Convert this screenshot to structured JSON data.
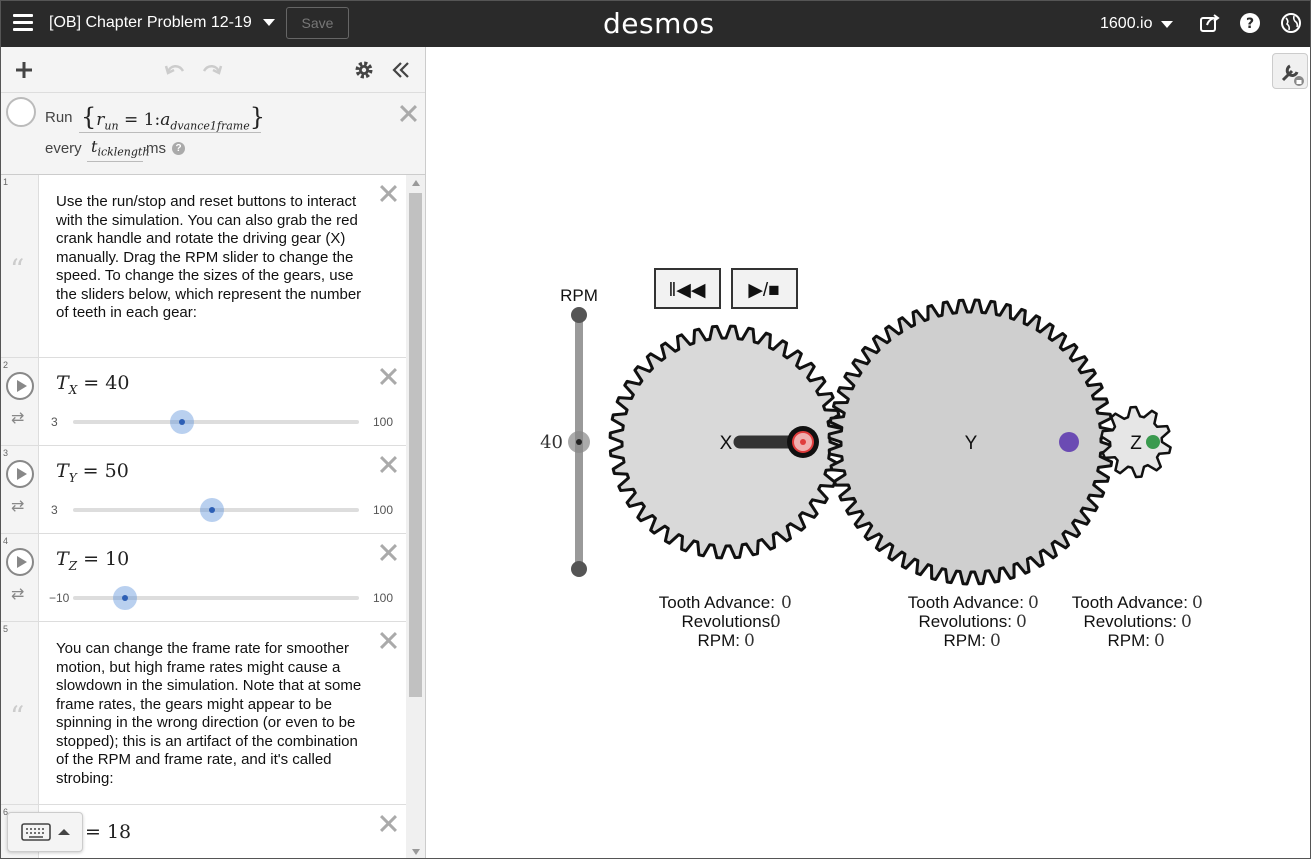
{
  "header": {
    "document_title": "[OB] Chapter Problem 12-19",
    "save_label": "Save",
    "brand": "desmos",
    "account": "1600.io"
  },
  "ticker": {
    "run_label": "Run",
    "expression_open": "{",
    "expression_r": "r",
    "expression_r_sub": "un",
    "expression_mid": " = 1:",
    "expression_a": "a",
    "expression_a_sub": "dvance1frame",
    "expression_close": "}",
    "every_label": "every",
    "interval_t": "t",
    "interval_t_sub": "icklength",
    "ms_label": "ms",
    "help_mark": "?"
  },
  "expressions": [
    {
      "num": "1",
      "type": "note",
      "text": "Use the run/stop and reset buttons to interact with the simulation. You can also grab the red crank handle and rotate the driving gear (X) manually. Drag the RPM slider to change the speed. To change the sizes of the gears, use the sliders below, which represent the number of teeth in each gear:"
    },
    {
      "num": "2",
      "type": "slider",
      "var": "T",
      "sub": "X",
      "equals": "= 40",
      "min": "3",
      "max": "100",
      "value": 40
    },
    {
      "num": "3",
      "type": "slider",
      "var": "T",
      "sub": "Y",
      "equals": "= 50",
      "min": "3",
      "max": "100",
      "value": 50
    },
    {
      "num": "4",
      "type": "slider",
      "var": "T",
      "sub": "Z",
      "equals": "= 10",
      "min": "−10",
      "max": "100",
      "value": 10
    },
    {
      "num": "5",
      "type": "note",
      "text": "You can change the frame rate for smoother motion, but high frame rates might cause a slowdown in the simulation. Note that at some frame rates, the gears might appear to be spinning in the wrong direction (or even to be stopped); this is an artifact of the combination of the RPM and frame rate, and it's called strobing:"
    },
    {
      "num": "6",
      "type": "partial",
      "equals": "= 18"
    }
  ],
  "graph": {
    "rpm_label": "RPM",
    "rpm_value": "40",
    "reset_button": "‖◀◀",
    "run_stop_button": "▶/■",
    "gears": [
      {
        "label": "X",
        "teeth": 40,
        "tooth_advance_label": "Tooth Advance:",
        "tooth_advance": "0",
        "revolutions_label": "Revolutions:",
        "revolutions": "0",
        "rpm_label": "RPM:",
        "rpm": "0"
      },
      {
        "label": "Y",
        "teeth": 50,
        "tooth_advance_label": "Tooth Advance:",
        "tooth_advance": "0",
        "revolutions_label": "Revolutions:",
        "revolutions": "0",
        "rpm_label": "RPM:",
        "rpm": "0"
      },
      {
        "label": "Z",
        "teeth": 10,
        "tooth_advance_label": "Tooth Advance:",
        "tooth_advance": "0",
        "revolutions_label": "Revolutions:",
        "revolutions": "0",
        "rpm_label": "RPM:",
        "rpm": "0"
      }
    ]
  },
  "colors": {
    "header_bg": "#2a2a2a",
    "gear_fill_x": "#d9d9d9",
    "gear_fill_y": "#cfcfcf",
    "gear_fill_z": "#e6e6e6",
    "crank_handle": "#e03c3c",
    "y_marker": "#6b4bb3",
    "z_marker": "#3a9a4f",
    "slider_thumb": "#2d5fb5"
  },
  "icons": {
    "menu": "hamburger-icon",
    "share": "share-icon",
    "help": "help-icon",
    "language": "globe-icon",
    "add": "plus-icon",
    "undo": "undo-icon",
    "redo": "redo-icon",
    "settings": "gear-icon",
    "collapse": "double-chevron-left-icon",
    "graph_settings": "wrench-icon",
    "keyboard": "keyboard-icon"
  }
}
